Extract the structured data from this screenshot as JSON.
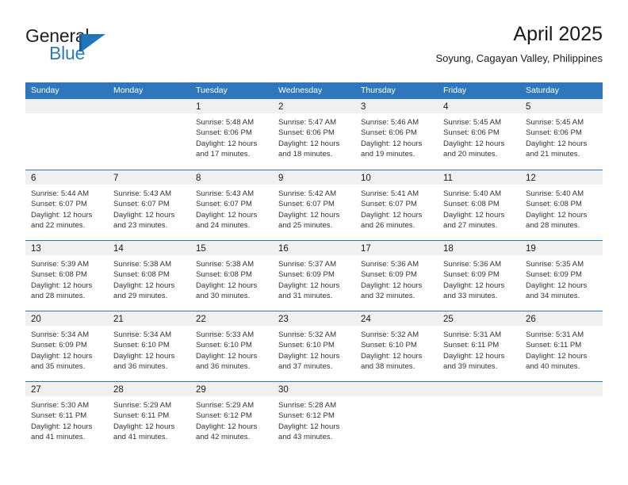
{
  "brand": {
    "name_part1": "General",
    "name_part2": "Blue",
    "logo_icon": "blue-flag-triangle-icon"
  },
  "header": {
    "title": "April 2025",
    "subtitle": "Soyung, Cagayan Valley, Philippines"
  },
  "colors": {
    "header_blue": "#2e77bd",
    "brand_blue": "#2e7ac0",
    "day_band_gray": "#f0f0f0",
    "text": "#333333"
  },
  "calendar": {
    "weekdays": [
      "Sunday",
      "Monday",
      "Tuesday",
      "Wednesday",
      "Thursday",
      "Friday",
      "Saturday"
    ],
    "weeks": [
      [
        {
          "day": "",
          "sunrise": "",
          "sunset": "",
          "daylight_line1": "",
          "daylight_line2": ""
        },
        {
          "day": "",
          "sunrise": "",
          "sunset": "",
          "daylight_line1": "",
          "daylight_line2": ""
        },
        {
          "day": "1",
          "sunrise": "Sunrise: 5:48 AM",
          "sunset": "Sunset: 6:06 PM",
          "daylight_line1": "Daylight: 12 hours",
          "daylight_line2": "and 17 minutes."
        },
        {
          "day": "2",
          "sunrise": "Sunrise: 5:47 AM",
          "sunset": "Sunset: 6:06 PM",
          "daylight_line1": "Daylight: 12 hours",
          "daylight_line2": "and 18 minutes."
        },
        {
          "day": "3",
          "sunrise": "Sunrise: 5:46 AM",
          "sunset": "Sunset: 6:06 PM",
          "daylight_line1": "Daylight: 12 hours",
          "daylight_line2": "and 19 minutes."
        },
        {
          "day": "4",
          "sunrise": "Sunrise: 5:45 AM",
          "sunset": "Sunset: 6:06 PM",
          "daylight_line1": "Daylight: 12 hours",
          "daylight_line2": "and 20 minutes."
        },
        {
          "day": "5",
          "sunrise": "Sunrise: 5:45 AM",
          "sunset": "Sunset: 6:06 PM",
          "daylight_line1": "Daylight: 12 hours",
          "daylight_line2": "and 21 minutes."
        }
      ],
      [
        {
          "day": "6",
          "sunrise": "Sunrise: 5:44 AM",
          "sunset": "Sunset: 6:07 PM",
          "daylight_line1": "Daylight: 12 hours",
          "daylight_line2": "and 22 minutes."
        },
        {
          "day": "7",
          "sunrise": "Sunrise: 5:43 AM",
          "sunset": "Sunset: 6:07 PM",
          "daylight_line1": "Daylight: 12 hours",
          "daylight_line2": "and 23 minutes."
        },
        {
          "day": "8",
          "sunrise": "Sunrise: 5:43 AM",
          "sunset": "Sunset: 6:07 PM",
          "daylight_line1": "Daylight: 12 hours",
          "daylight_line2": "and 24 minutes."
        },
        {
          "day": "9",
          "sunrise": "Sunrise: 5:42 AM",
          "sunset": "Sunset: 6:07 PM",
          "daylight_line1": "Daylight: 12 hours",
          "daylight_line2": "and 25 minutes."
        },
        {
          "day": "10",
          "sunrise": "Sunrise: 5:41 AM",
          "sunset": "Sunset: 6:07 PM",
          "daylight_line1": "Daylight: 12 hours",
          "daylight_line2": "and 26 minutes."
        },
        {
          "day": "11",
          "sunrise": "Sunrise: 5:40 AM",
          "sunset": "Sunset: 6:08 PM",
          "daylight_line1": "Daylight: 12 hours",
          "daylight_line2": "and 27 minutes."
        },
        {
          "day": "12",
          "sunrise": "Sunrise: 5:40 AM",
          "sunset": "Sunset: 6:08 PM",
          "daylight_line1": "Daylight: 12 hours",
          "daylight_line2": "and 28 minutes."
        }
      ],
      [
        {
          "day": "13",
          "sunrise": "Sunrise: 5:39 AM",
          "sunset": "Sunset: 6:08 PM",
          "daylight_line1": "Daylight: 12 hours",
          "daylight_line2": "and 28 minutes."
        },
        {
          "day": "14",
          "sunrise": "Sunrise: 5:38 AM",
          "sunset": "Sunset: 6:08 PM",
          "daylight_line1": "Daylight: 12 hours",
          "daylight_line2": "and 29 minutes."
        },
        {
          "day": "15",
          "sunrise": "Sunrise: 5:38 AM",
          "sunset": "Sunset: 6:08 PM",
          "daylight_line1": "Daylight: 12 hours",
          "daylight_line2": "and 30 minutes."
        },
        {
          "day": "16",
          "sunrise": "Sunrise: 5:37 AM",
          "sunset": "Sunset: 6:09 PM",
          "daylight_line1": "Daylight: 12 hours",
          "daylight_line2": "and 31 minutes."
        },
        {
          "day": "17",
          "sunrise": "Sunrise: 5:36 AM",
          "sunset": "Sunset: 6:09 PM",
          "daylight_line1": "Daylight: 12 hours",
          "daylight_line2": "and 32 minutes."
        },
        {
          "day": "18",
          "sunrise": "Sunrise: 5:36 AM",
          "sunset": "Sunset: 6:09 PM",
          "daylight_line1": "Daylight: 12 hours",
          "daylight_line2": "and 33 minutes."
        },
        {
          "day": "19",
          "sunrise": "Sunrise: 5:35 AM",
          "sunset": "Sunset: 6:09 PM",
          "daylight_line1": "Daylight: 12 hours",
          "daylight_line2": "and 34 minutes."
        }
      ],
      [
        {
          "day": "20",
          "sunrise": "Sunrise: 5:34 AM",
          "sunset": "Sunset: 6:09 PM",
          "daylight_line1": "Daylight: 12 hours",
          "daylight_line2": "and 35 minutes."
        },
        {
          "day": "21",
          "sunrise": "Sunrise: 5:34 AM",
          "sunset": "Sunset: 6:10 PM",
          "daylight_line1": "Daylight: 12 hours",
          "daylight_line2": "and 36 minutes."
        },
        {
          "day": "22",
          "sunrise": "Sunrise: 5:33 AM",
          "sunset": "Sunset: 6:10 PM",
          "daylight_line1": "Daylight: 12 hours",
          "daylight_line2": "and 36 minutes."
        },
        {
          "day": "23",
          "sunrise": "Sunrise: 5:32 AM",
          "sunset": "Sunset: 6:10 PM",
          "daylight_line1": "Daylight: 12 hours",
          "daylight_line2": "and 37 minutes."
        },
        {
          "day": "24",
          "sunrise": "Sunrise: 5:32 AM",
          "sunset": "Sunset: 6:10 PM",
          "daylight_line1": "Daylight: 12 hours",
          "daylight_line2": "and 38 minutes."
        },
        {
          "day": "25",
          "sunrise": "Sunrise: 5:31 AM",
          "sunset": "Sunset: 6:11 PM",
          "daylight_line1": "Daylight: 12 hours",
          "daylight_line2": "and 39 minutes."
        },
        {
          "day": "26",
          "sunrise": "Sunrise: 5:31 AM",
          "sunset": "Sunset: 6:11 PM",
          "daylight_line1": "Daylight: 12 hours",
          "daylight_line2": "and 40 minutes."
        }
      ],
      [
        {
          "day": "27",
          "sunrise": "Sunrise: 5:30 AM",
          "sunset": "Sunset: 6:11 PM",
          "daylight_line1": "Daylight: 12 hours",
          "daylight_line2": "and 41 minutes."
        },
        {
          "day": "28",
          "sunrise": "Sunrise: 5:29 AM",
          "sunset": "Sunset: 6:11 PM",
          "daylight_line1": "Daylight: 12 hours",
          "daylight_line2": "and 41 minutes."
        },
        {
          "day": "29",
          "sunrise": "Sunrise: 5:29 AM",
          "sunset": "Sunset: 6:12 PM",
          "daylight_line1": "Daylight: 12 hours",
          "daylight_line2": "and 42 minutes."
        },
        {
          "day": "30",
          "sunrise": "Sunrise: 5:28 AM",
          "sunset": "Sunset: 6:12 PM",
          "daylight_line1": "Daylight: 12 hours",
          "daylight_line2": "and 43 minutes."
        },
        {
          "day": "",
          "sunrise": "",
          "sunset": "",
          "daylight_line1": "",
          "daylight_line2": ""
        },
        {
          "day": "",
          "sunrise": "",
          "sunset": "",
          "daylight_line1": "",
          "daylight_line2": ""
        },
        {
          "day": "",
          "sunrise": "",
          "sunset": "",
          "daylight_line1": "",
          "daylight_line2": ""
        }
      ]
    ]
  }
}
